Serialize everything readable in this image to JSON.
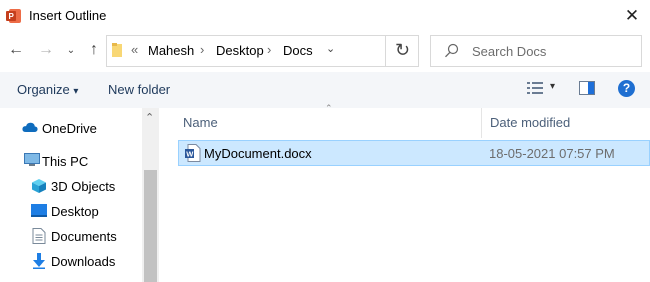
{
  "window": {
    "title": "Insert Outline"
  },
  "address": {
    "chevron": "«",
    "crumbs": [
      "Mahesh",
      "Desktop",
      "Docs"
    ],
    "separator": "›"
  },
  "search": {
    "placeholder": "Search Docs"
  },
  "toolbar": {
    "organize_label": "Organize",
    "organize_caret": "▾",
    "new_folder_label": "New folder",
    "view_caret": "▾",
    "help_label": "?"
  },
  "sidebar": {
    "items": [
      {
        "label": "OneDrive",
        "icon": "onedrive-icon"
      },
      {
        "label": "This PC",
        "icon": "computer-icon"
      },
      {
        "label": "3D Objects",
        "icon": "3d-objects-icon"
      },
      {
        "label": "Desktop",
        "icon": "desktop-icon"
      },
      {
        "label": "Documents",
        "icon": "documents-icon"
      },
      {
        "label": "Downloads",
        "icon": "downloads-icon"
      }
    ]
  },
  "list": {
    "columns": [
      "Name",
      "Date modified"
    ],
    "files": [
      {
        "name": "MyDocument.docx",
        "date_modified": "18-05-2021 07:57 PM",
        "icon": "word-doc-icon"
      }
    ]
  },
  "colors": {
    "accent": "#0078d7",
    "selection": "#cce8ff",
    "toolbar_bg": "#f4f6f9",
    "folder": "#f8d775",
    "word": "#2b579a",
    "powerpoint": "#d24726"
  }
}
